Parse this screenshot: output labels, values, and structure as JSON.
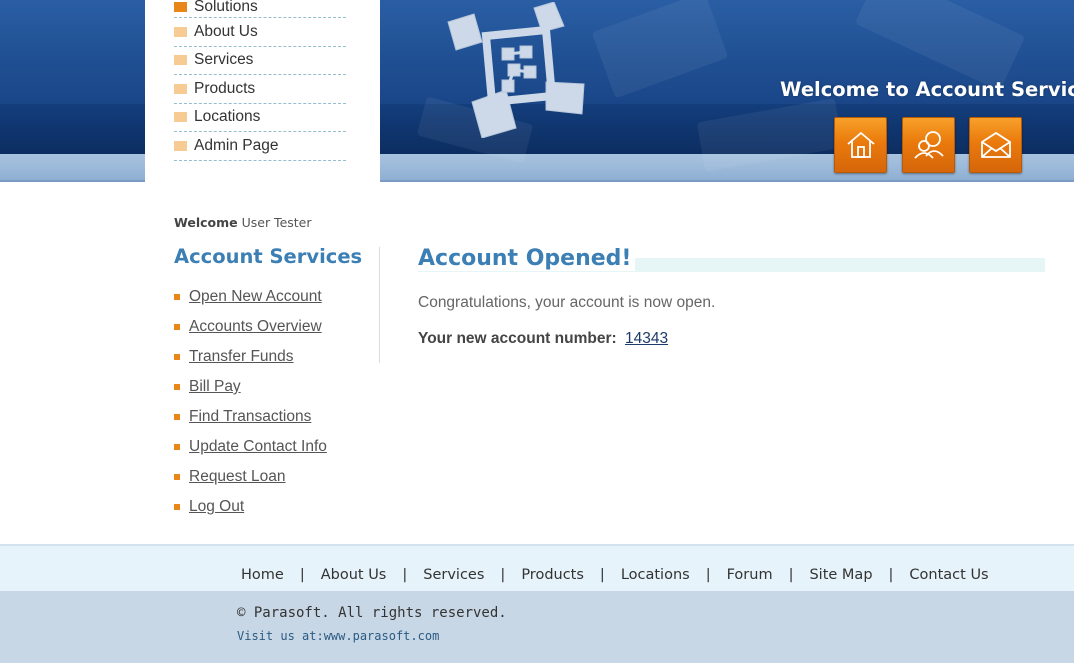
{
  "header": {
    "title": "Welcome to Account Services",
    "buttons": [
      {
        "name": "home",
        "icon": "home-icon"
      },
      {
        "name": "about",
        "icon": "people-icon"
      },
      {
        "name": "contact",
        "icon": "envelope-icon"
      }
    ],
    "colors": {
      "banner": "#1d4d8f",
      "button": "#ea7a0c"
    }
  },
  "top_menu": {
    "items": [
      {
        "label": "Solutions",
        "active": true
      },
      {
        "label": "About Us"
      },
      {
        "label": "Services"
      },
      {
        "label": "Products"
      },
      {
        "label": "Locations"
      },
      {
        "label": "Admin Page"
      }
    ]
  },
  "user": {
    "welcome_label": "Welcome",
    "name": "User Tester"
  },
  "account_services": {
    "heading": "Account Services",
    "links": [
      {
        "label": "Open New Account"
      },
      {
        "label": "Accounts Overview"
      },
      {
        "label": "Transfer Funds"
      },
      {
        "label": "Bill Pay"
      },
      {
        "label": "Find Transactions"
      },
      {
        "label": "Update Contact Info"
      },
      {
        "label": "Request Loan"
      },
      {
        "label": "Log Out"
      }
    ]
  },
  "main": {
    "title": "Account Opened!",
    "message": "Congratulations, your account is now open.",
    "account_number_label": "Your new account number:",
    "account_number": "14343"
  },
  "footer": {
    "links": [
      {
        "label": "Home"
      },
      {
        "label": "About Us"
      },
      {
        "label": "Services"
      },
      {
        "label": "Products"
      },
      {
        "label": "Locations"
      },
      {
        "label": "Forum"
      },
      {
        "label": "Site Map"
      },
      {
        "label": "Contact Us"
      }
    ],
    "separator": "|",
    "copyright": "© Parasoft. All rights reserved.",
    "visit_label": "Visit us at:",
    "visit_url": "www.parasoft.com"
  }
}
